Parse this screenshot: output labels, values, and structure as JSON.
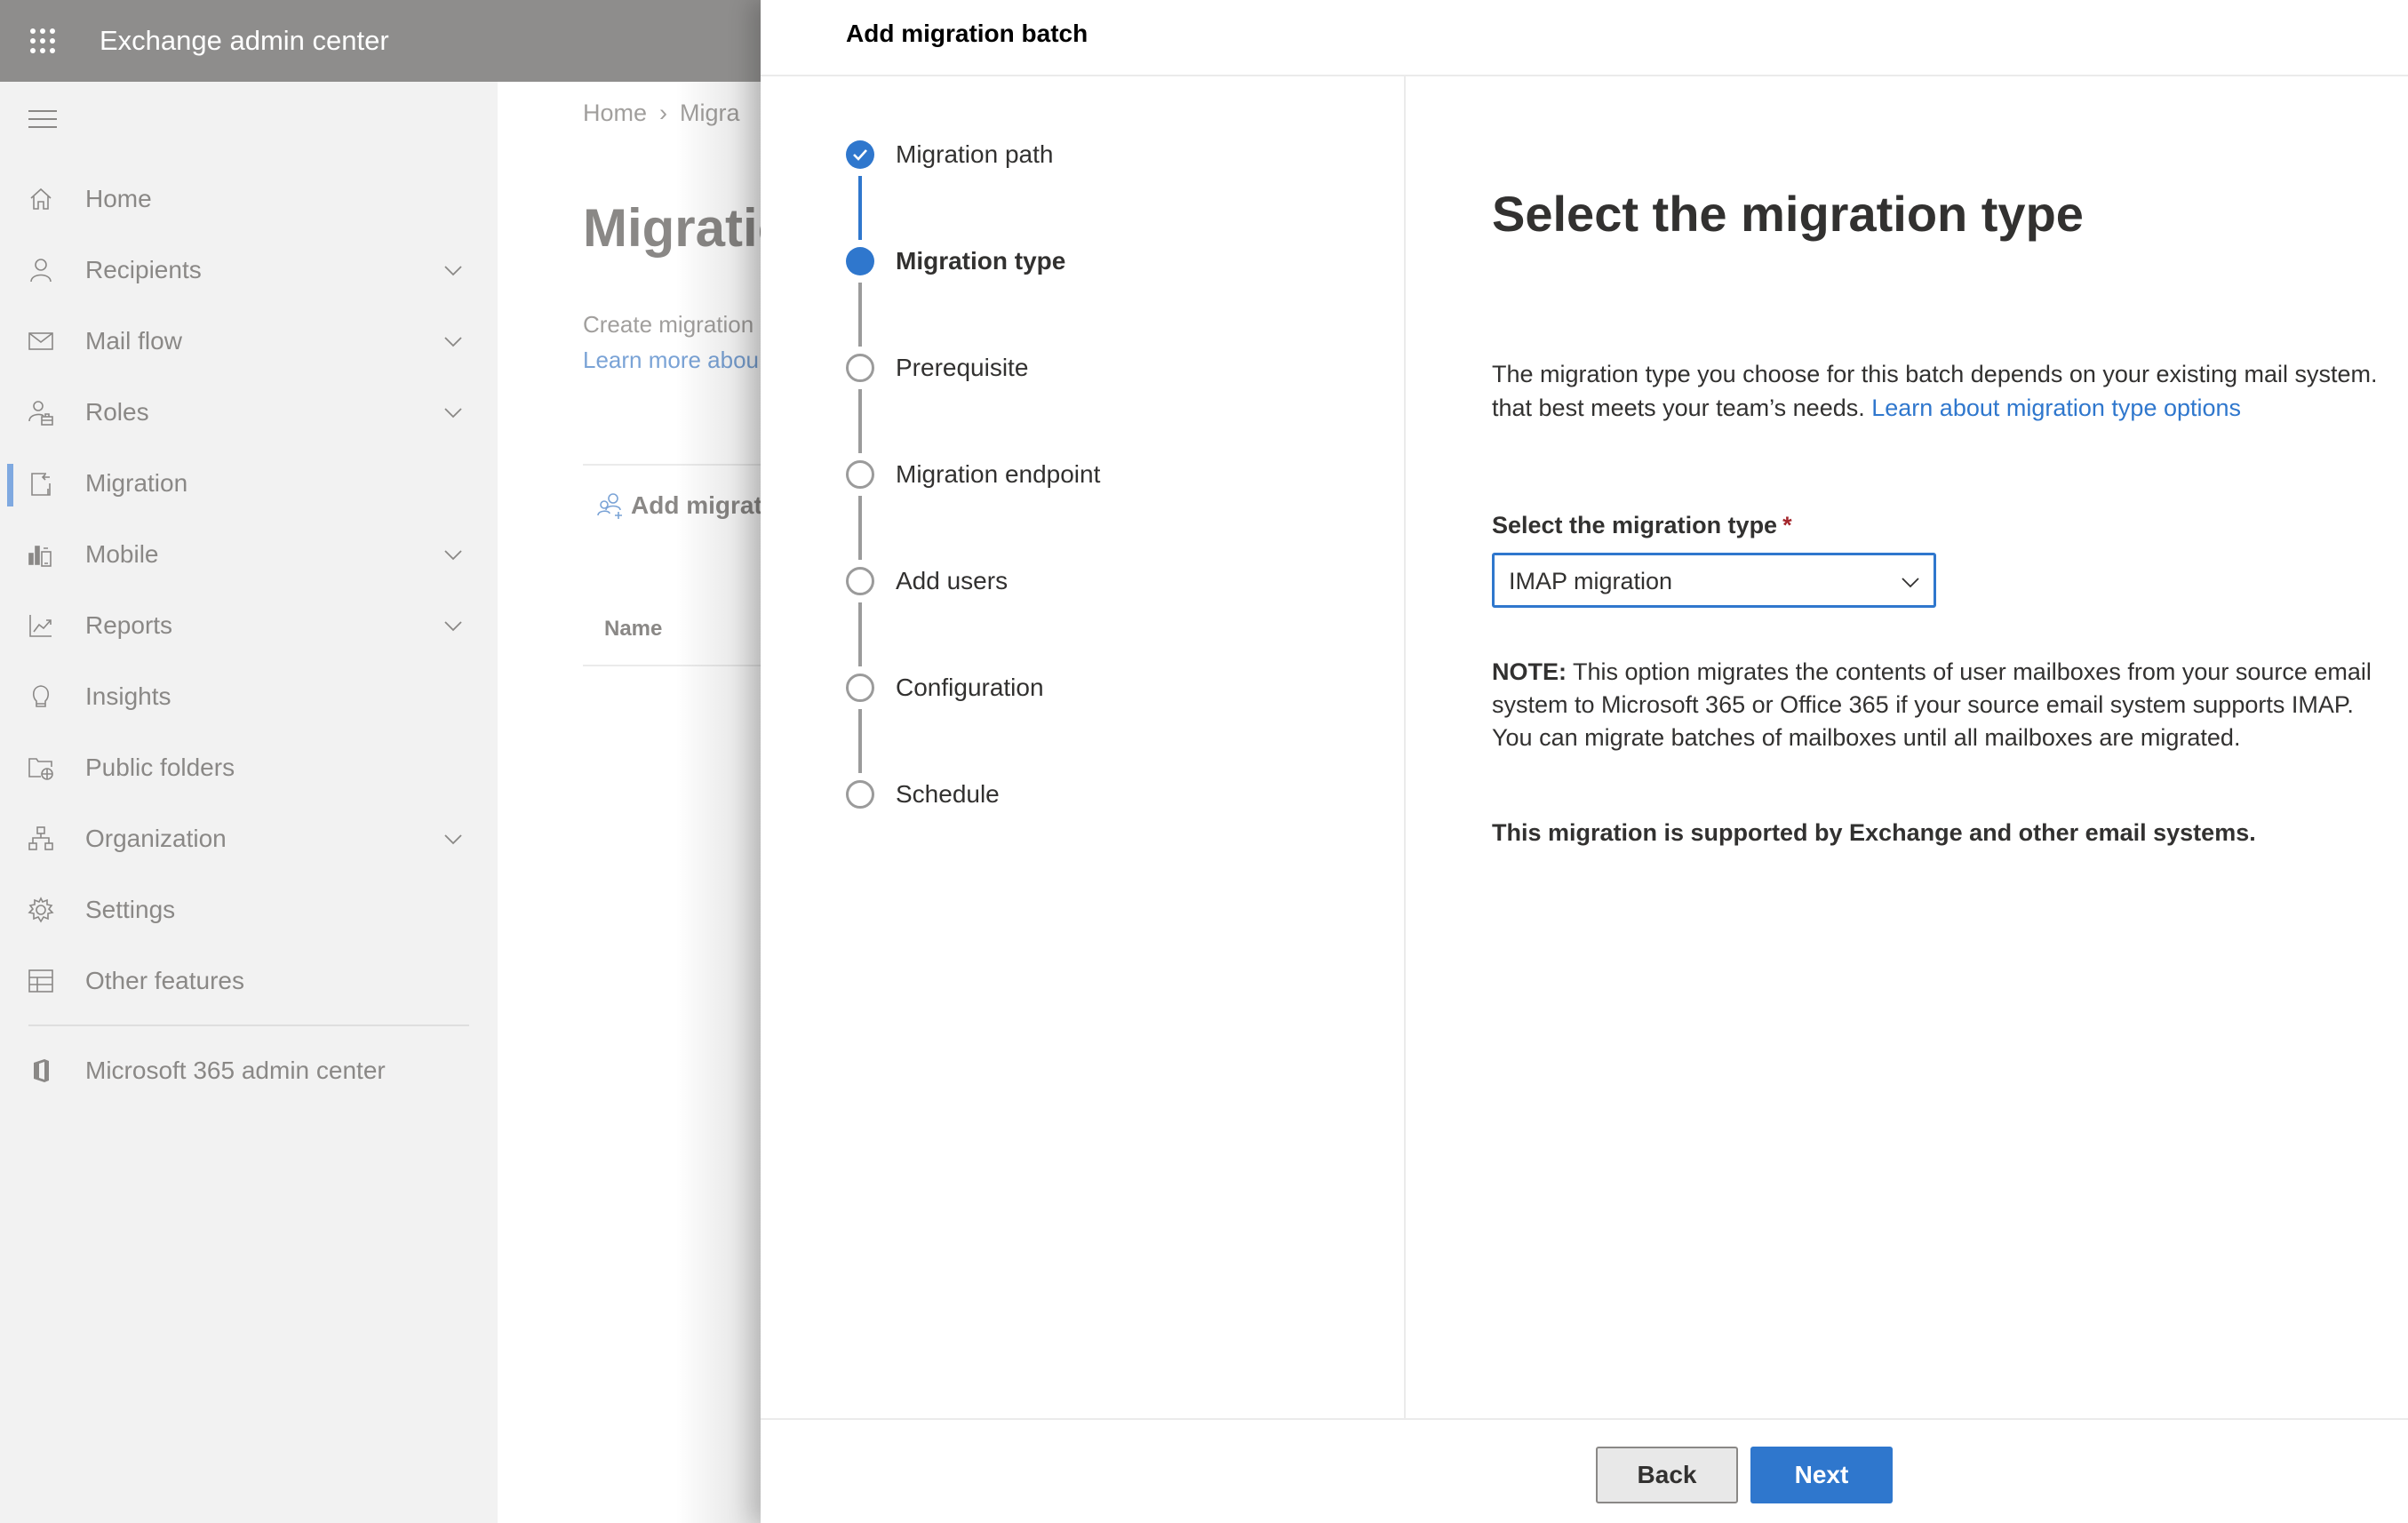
{
  "app": {
    "title": "Exchange admin center"
  },
  "sidebar": {
    "items": [
      {
        "label": "Home",
        "icon": "home-icon",
        "expandable": false,
        "selected": false
      },
      {
        "label": "Recipients",
        "icon": "person-icon",
        "expandable": true,
        "selected": false
      },
      {
        "label": "Mail flow",
        "icon": "mail-icon",
        "expandable": true,
        "selected": false
      },
      {
        "label": "Roles",
        "icon": "roles-icon",
        "expandable": true,
        "selected": false
      },
      {
        "label": "Migration",
        "icon": "migration-icon",
        "expandable": false,
        "selected": true
      },
      {
        "label": "Mobile",
        "icon": "mobile-icon",
        "expandable": true,
        "selected": false
      },
      {
        "label": "Reports",
        "icon": "chart-icon",
        "expandable": true,
        "selected": false
      },
      {
        "label": "Insights",
        "icon": "lightbulb-icon",
        "expandable": false,
        "selected": false
      },
      {
        "label": "Public folders",
        "icon": "public-folder-icon",
        "expandable": false,
        "selected": false
      },
      {
        "label": "Organization",
        "icon": "org-chart-icon",
        "expandable": true,
        "selected": false
      },
      {
        "label": "Settings",
        "icon": "gear-icon",
        "expandable": false,
        "selected": false
      },
      {
        "label": "Other features",
        "icon": "table-icon",
        "expandable": false,
        "selected": false
      }
    ],
    "footer_item": {
      "label": "Microsoft 365 admin center",
      "icon": "office-icon"
    }
  },
  "page": {
    "breadcrumb": [
      "Home",
      "Migra"
    ],
    "title": "Migratio",
    "description": "Create migration",
    "learn_more": "Learn more abou",
    "command": "Add migrat",
    "column_header": "Name"
  },
  "panel": {
    "title": "Add migration batch",
    "steps": [
      {
        "label": "Migration path",
        "state": "done"
      },
      {
        "label": "Migration type",
        "state": "current"
      },
      {
        "label": "Prerequisite",
        "state": "todo"
      },
      {
        "label": "Migration endpoint",
        "state": "todo"
      },
      {
        "label": "Add users",
        "state": "todo"
      },
      {
        "label": "Configuration",
        "state": "todo"
      },
      {
        "label": "Schedule",
        "state": "todo"
      }
    ],
    "content": {
      "heading": "Select the migration type",
      "description_line1": "The migration type you choose for this batch depends on your existing mail system.",
      "description_line2": "that best meets your team’s needs.",
      "description_link": "Learn about migration type options",
      "field_label": "Select the migration type",
      "required_marker": "*",
      "selected_value": "IMAP migration",
      "note_prefix": "NOTE:",
      "note_text": "This option migrates the contents of user mailboxes from your source email system to Microsoft 365 or Office 365 if your source email system supports IMAP. You can migrate batches of mailboxes until all mailboxes are migrated.",
      "support_text": "This migration is supported by Exchange and other email systems."
    },
    "buttons": {
      "back": "Back",
      "next": "Next"
    }
  },
  "colors": {
    "accent": "#2f77cd",
    "header_bg": "#8e8d8c",
    "sidebar_bg": "#f2f2f2",
    "required": "#a4262c"
  }
}
